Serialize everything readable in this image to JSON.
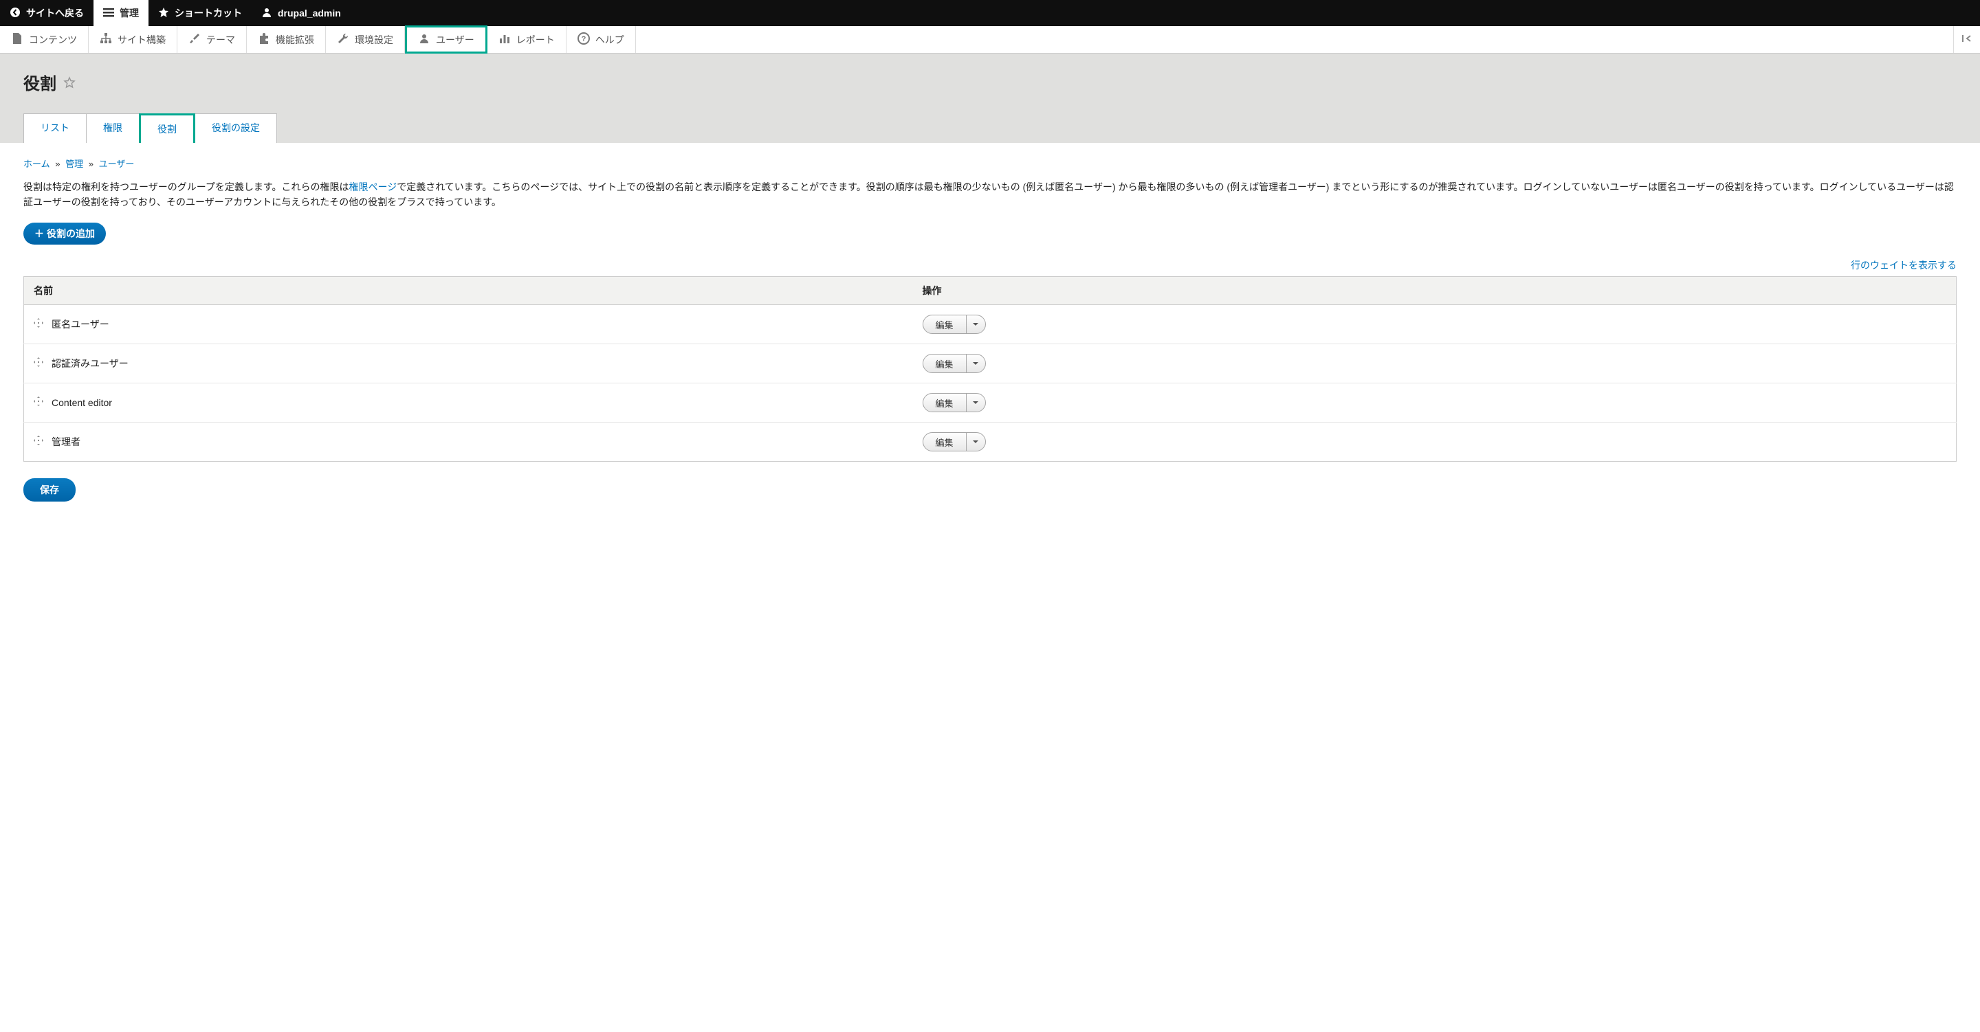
{
  "topToolbar": {
    "backToSite": "サイトへ戻る",
    "manage": "管理",
    "shortcuts": "ショートカット",
    "user": "drupal_admin"
  },
  "adminMenu": {
    "content": "コンテンツ",
    "structure": "サイト構築",
    "appearance": "テーマ",
    "extend": "機能拡張",
    "configuration": "環境設定",
    "people": "ユーザー",
    "reports": "レポート",
    "help": "ヘルプ"
  },
  "page": {
    "title": "役割"
  },
  "tabs": {
    "list": "リスト",
    "permissions": "権限",
    "roles": "役割",
    "roleSettings": "役割の設定"
  },
  "breadcrumb": {
    "home": "ホーム",
    "admin": "管理",
    "people": "ユーザー"
  },
  "description": {
    "part1": "役割は特定の権利を持つユーザーのグループを定義します。これらの権限は",
    "permLink": "権限ページ",
    "part2": "で定義されています。こちらのページでは、サイト上での役割の名前と表示順序を定義することができます。役割の順序は最も権限の少ないもの (例えば匿名ユーザー) から最も権限の多いもの (例えば管理者ユーザー) までという形にするのが推奨されています。ログインしていないユーザーは匿名ユーザーの役割を持っています。ログインしているユーザーは認証ユーザーの役割を持っており、そのユーザーアカウントに与えられたその他の役割をプラスで持っています。"
  },
  "buttons": {
    "addRole": "役割の追加",
    "save": "保存",
    "edit": "編集"
  },
  "links": {
    "showWeights": "行のウェイトを表示する"
  },
  "table": {
    "headers": {
      "name": "名前",
      "operations": "操作"
    },
    "rows": [
      {
        "name": "匿名ユーザー"
      },
      {
        "name": "認証済みユーザー"
      },
      {
        "name": "Content editor"
      },
      {
        "name": "管理者"
      }
    ]
  }
}
